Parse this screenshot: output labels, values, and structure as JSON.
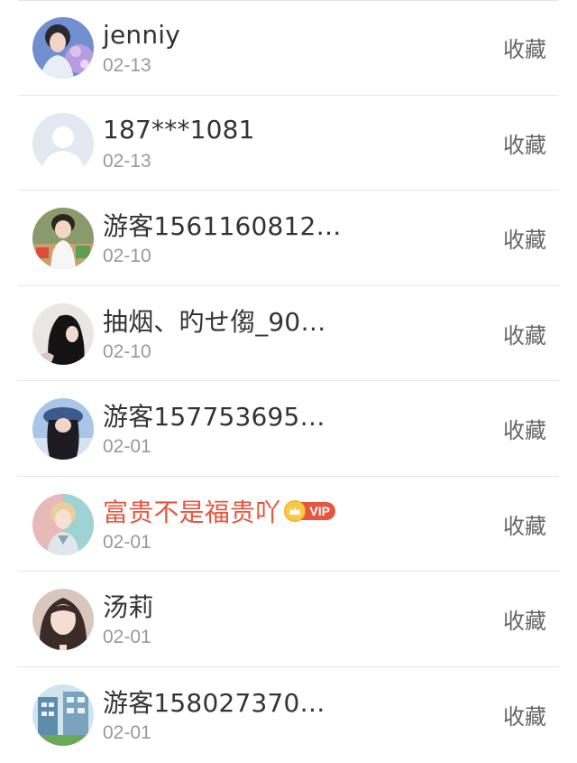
{
  "list": {
    "items": [
      {
        "name": "jenniy",
        "date": "02-13",
        "action": "收藏",
        "avatar": "photo-girl-flowers"
      },
      {
        "name": "187***1081",
        "date": "02-13",
        "action": "收藏",
        "avatar": "default-person"
      },
      {
        "name": "游客1561160812…",
        "date": "02-10",
        "action": "收藏",
        "avatar": "photo-boy-food"
      },
      {
        "name": "抽烟、旳せ㑳_90…",
        "date": "02-10",
        "action": "收藏",
        "avatar": "photo-dark-hair"
      },
      {
        "name": "游客157753695…",
        "date": "02-01",
        "action": "收藏",
        "avatar": "photo-cap-girl"
      },
      {
        "name": "富贵不是福贵吖",
        "date": "02-01",
        "action": "收藏",
        "avatar": "photo-blonde-boy",
        "vip": true,
        "vip_label": "VIP",
        "name_color": "#e8553e"
      },
      {
        "name": "汤莉",
        "date": "02-01",
        "action": "收藏",
        "avatar": "photo-girl-portrait"
      },
      {
        "name": "游客158027370…",
        "date": "02-01",
        "action": "收藏",
        "avatar": "photo-building"
      }
    ]
  }
}
